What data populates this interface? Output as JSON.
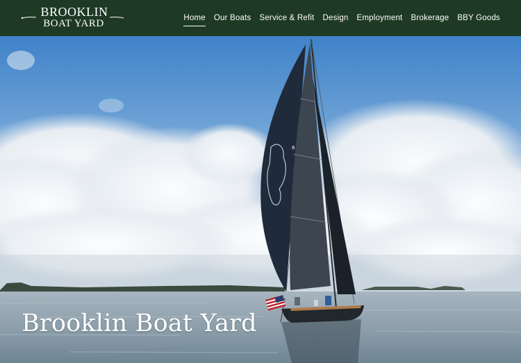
{
  "header": {
    "logo": {
      "line1": "BROOKLIN",
      "line2": "BOAT YARD"
    },
    "nav": [
      {
        "label": "Home",
        "active": true
      },
      {
        "label": "Our Boats",
        "active": false
      },
      {
        "label": "Service & Refit",
        "active": false
      },
      {
        "label": "Design",
        "active": false
      },
      {
        "label": "Employment",
        "active": false
      },
      {
        "label": "Brokerage",
        "active": false
      },
      {
        "label": "BBY Goods",
        "active": false
      }
    ]
  },
  "hero": {
    "title": "Brooklin Boat Yard",
    "image": "sailboat-on-water-photo"
  },
  "colors": {
    "header_bg": "#1e3a24",
    "sky": "#4f8fd0",
    "water": "#8fa2ae"
  }
}
